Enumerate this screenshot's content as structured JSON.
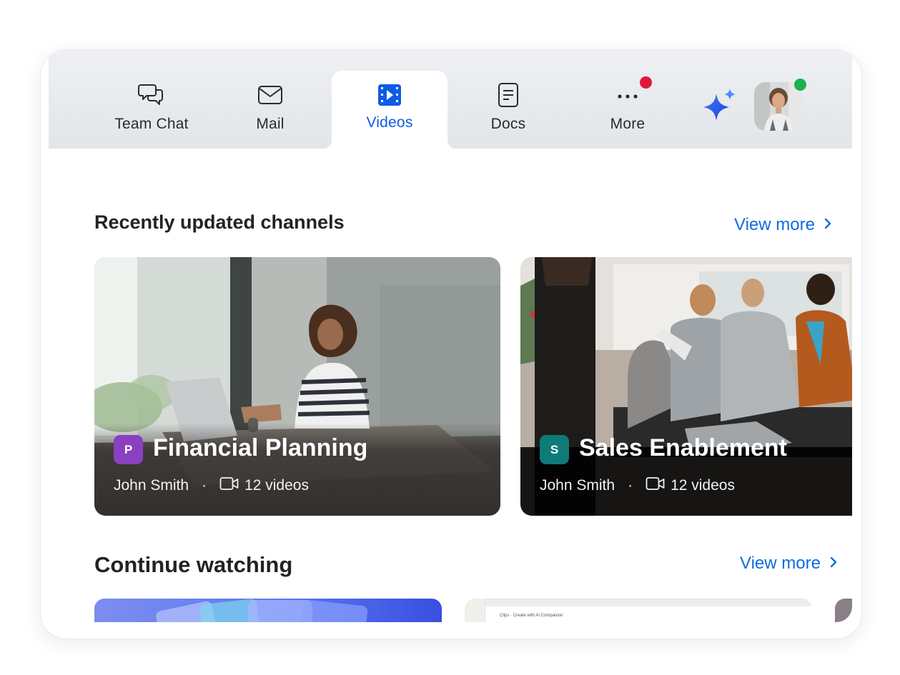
{
  "nav": {
    "tabs": [
      {
        "label": "Team Chat",
        "icon": "chat-bubbles-icon"
      },
      {
        "label": "Mail",
        "icon": "mail-icon"
      },
      {
        "label": "Videos",
        "icon": "video-clip-icon",
        "active": true
      },
      {
        "label": "Docs",
        "icon": "document-icon"
      },
      {
        "label": "More",
        "icon": "more-dots-icon",
        "has_notification": true
      }
    ],
    "ai_companion_icon": "ai-sparkle-icon",
    "avatar_status": "online"
  },
  "recent_channels": {
    "title": "Recently updated channels",
    "view_more": "View more",
    "cards": [
      {
        "initial": "P",
        "name": "Financial Planning",
        "owner": "John Smith",
        "separator": "·",
        "videos": "12 videos",
        "chip_color": "#8b3fc1"
      },
      {
        "initial": "S",
        "name": "Sales Enablement",
        "owner": "John Smith",
        "separator": "·",
        "videos": "12 videos",
        "chip_color": "#0f7b78"
      }
    ]
  },
  "continue_watching": {
    "title": "Continue watching",
    "view_more": "View more",
    "thumbnail_caption": "Clips · Create with AI Companion"
  },
  "colors": {
    "accent": "#0e6be0",
    "active_tab": "#0e5ce6",
    "notification": "#e0173d",
    "online": "#1bb14c"
  }
}
